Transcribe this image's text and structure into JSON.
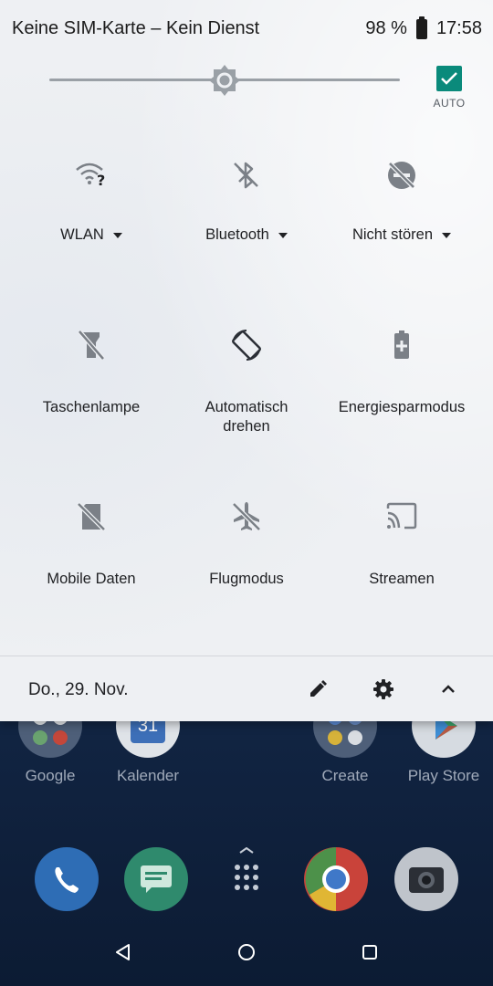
{
  "status_bar": {
    "carrier_text": "Keine SIM-Karte – Kein Dienst",
    "battery_percent": "98 %",
    "time": "17:58",
    "battery_icon": "battery-full-icon"
  },
  "brightness": {
    "level": 0.5,
    "auto_label": "AUTO",
    "auto_checked": true,
    "icon": "brightness-icon"
  },
  "quick_settings": {
    "row1": [
      {
        "label": "WLAN",
        "icon": "wifi-unknown-icon",
        "has_dropdown": true
      },
      {
        "label": "Bluetooth",
        "icon": "bluetooth-off-icon",
        "has_dropdown": true
      },
      {
        "label": "Nicht stören",
        "icon": "do-not-disturb-off-icon",
        "has_dropdown": true
      }
    ],
    "row2": [
      {
        "label": "Taschenlampe",
        "icon": "flashlight-off-icon"
      },
      {
        "label_line1": "Automatisch",
        "label_line2": "drehen",
        "icon": "auto-rotate-icon"
      },
      {
        "label": "Energiesparmodus",
        "icon": "battery-saver-icon"
      }
    ],
    "row3": [
      {
        "label": "Mobile Daten",
        "icon": "mobile-data-off-icon"
      },
      {
        "label": "Flugmodus",
        "icon": "airplane-off-icon"
      },
      {
        "label": "Streamen",
        "icon": "cast-icon"
      }
    ]
  },
  "footer": {
    "date": "Do., 29. Nov.",
    "edit_icon": "edit-pencil-icon",
    "settings_icon": "gear-icon",
    "collapse_icon": "chevron-up-icon"
  },
  "home_screen": {
    "apps": [
      {
        "label": "Google",
        "icon": "google-folder-icon"
      },
      {
        "label": "Kalender",
        "icon": "calendar-icon",
        "badge": "31"
      },
      {
        "label": "Create",
        "icon": "create-folder-icon"
      },
      {
        "label": "Play Store",
        "icon": "play-store-icon"
      }
    ],
    "dock": [
      "phone-icon",
      "messages-icon",
      "app-drawer-icon",
      "chrome-icon",
      "camera-icon"
    ]
  },
  "navigation": {
    "back_icon": "back-triangle-icon",
    "home_icon": "home-circle-icon",
    "recents_icon": "recents-square-icon"
  }
}
